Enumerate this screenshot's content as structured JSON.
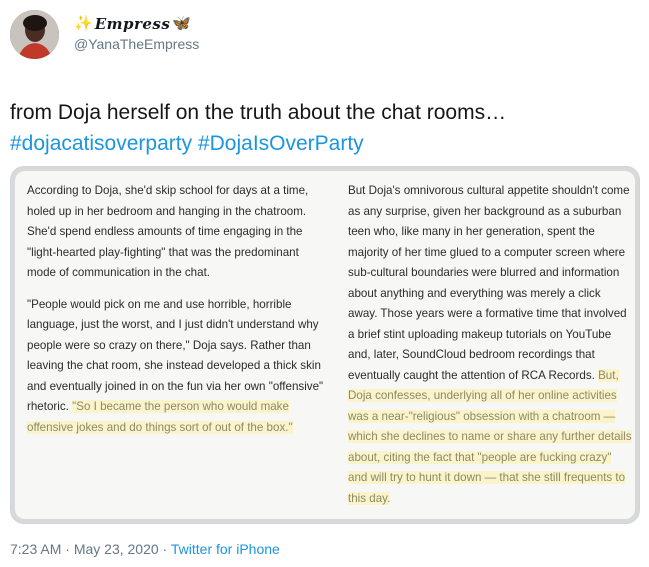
{
  "user": {
    "display_name_prefix": "✨",
    "display_name": "Empress",
    "display_name_suffix": "🦋",
    "handle": "@YanaTheEmpress"
  },
  "tweet": {
    "text": "from Doja herself on the truth about the chat rooms…",
    "hashtags": [
      "#dojacatisoverparty",
      "#DojaIsOverParty"
    ]
  },
  "media": {
    "left_column": {
      "p1": "According to Doja, she'd skip school for days at a time, holed up in her bedroom and hanging in the chatroom. She'd spend endless amounts of time engaging in the \"light-hearted play-fighting\" that was the predominant mode of communication in the chat.",
      "p2": "\"People would pick on me and use horrible, horrible language, just the worst, and I just didn't understand why people were so crazy on there,\" Doja says. Rather than leaving the chat room, she instead developed a thick skin and eventually joined in on the fun via her own \"offensive\" rhetoric.",
      "p2_highlight": "\"So I became the person who would make offensive jokes and do things sort of out of the box.\""
    },
    "right_column": {
      "p1": "But Doja's omnivorous cultural appetite shouldn't come as any surprise, given her background as a suburban teen who, like many in her generation, spent the majority of her time glued to a computer screen where sub-cultural boundaries were blurred and information about anything and everything was merely a click away. Those years were a formative time that involved a brief stint uploading makeup tutorials on YouTube and, later, SoundCloud bedroom recordings that eventually caught the attention of RCA Records.",
      "p1_highlight": "But, Doja confesses, underlying all of her online activities was a near-\"religious\" obsession with a chatroom — which she declines to name or share any further details about, citing the fact that \"people are fucking crazy\" and will try to hunt it down — that she still frequents to this day."
    }
  },
  "meta": {
    "time": "7:23 AM",
    "separator": " · ",
    "date": "May 23, 2020",
    "source": "Twitter for iPhone"
  },
  "colors": {
    "link": "#1b95e0",
    "secondary_text": "#657786",
    "highlight": "#fbf3c9"
  }
}
